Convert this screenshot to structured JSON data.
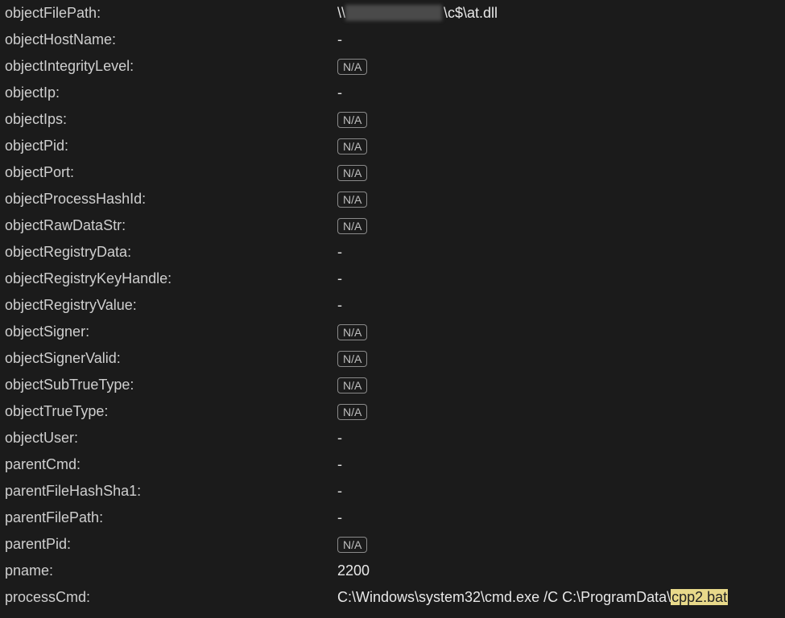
{
  "na_label": "N/A",
  "dash": "-",
  "rows": [
    {
      "key": "objectFilePath:",
      "type": "filepath",
      "prefix": "\\\\",
      "suffix": "\\c$\\at.dll"
    },
    {
      "key": "objectHostName:",
      "type": "dash"
    },
    {
      "key": "objectIntegrityLevel:",
      "type": "na"
    },
    {
      "key": "objectIp:",
      "type": "dash"
    },
    {
      "key": "objectIps:",
      "type": "na"
    },
    {
      "key": "objectPid:",
      "type": "na"
    },
    {
      "key": "objectPort:",
      "type": "na"
    },
    {
      "key": "objectProcessHashId:",
      "type": "na"
    },
    {
      "key": "objectRawDataStr:",
      "type": "na"
    },
    {
      "key": "objectRegistryData:",
      "type": "dash"
    },
    {
      "key": "objectRegistryKeyHandle:",
      "type": "dash"
    },
    {
      "key": "objectRegistryValue:",
      "type": "dash"
    },
    {
      "key": "objectSigner:",
      "type": "na"
    },
    {
      "key": "objectSignerValid:",
      "type": "na"
    },
    {
      "key": "objectSubTrueType:",
      "type": "na"
    },
    {
      "key": "objectTrueType:",
      "type": "na"
    },
    {
      "key": "objectUser:",
      "type": "dash"
    },
    {
      "key": "parentCmd:",
      "type": "dash"
    },
    {
      "key": "parentFileHashSha1:",
      "type": "dash"
    },
    {
      "key": "parentFilePath:",
      "type": "dash"
    },
    {
      "key": "parentPid:",
      "type": "na"
    },
    {
      "key": "pname:",
      "type": "text",
      "value": "2200"
    },
    {
      "key": "processCmd:",
      "type": "cmd",
      "prefix": "C:\\Windows\\system32\\cmd.exe /C C:\\ProgramData\\",
      "highlight": "cpp2.bat"
    }
  ]
}
